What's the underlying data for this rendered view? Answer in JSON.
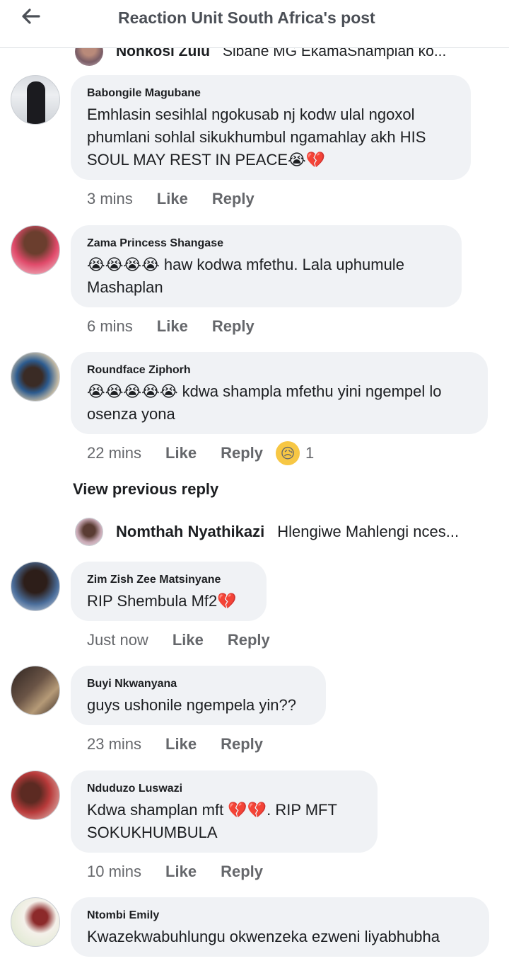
{
  "header": {
    "title": "Reaction Unit South Africa's post",
    "back_icon": "arrow-left-icon"
  },
  "partial_reply": {
    "name": "Nonkosi Zulu",
    "text": "Sibane MG EkamaShamplan ko..."
  },
  "comments": [
    {
      "author": "Babongile Magubane",
      "text": "Emhlasin sesihlal ngokusab nj kodw ulal ngoxol phumlani sohlal sikukhumbul ngamahlay akh HIS SOUL MAY REST IN PEACE😭💔",
      "time": "3 mins",
      "like": "Like",
      "reply": "Reply"
    },
    {
      "author": "Zama Princess Shangase",
      "text": "😭😭😭😭 haw kodwa mfethu. Lala uphumule Mashaplan",
      "time": "6 mins",
      "like": "Like",
      "reply": "Reply"
    },
    {
      "author": "Roundface Ziphorh",
      "text": "😭😭😭😭😭 kdwa shampla mfethu yini ngempel lo osenza yona",
      "time": "22 mins",
      "like": "Like",
      "reply": "Reply",
      "reaction_emoji": "😥",
      "reaction_count": "1"
    },
    {
      "author": "Zim Zish Zee Matsinyane",
      "text": "RIP Shembula Mf2💔",
      "time": "Just now",
      "like": "Like",
      "reply": "Reply"
    },
    {
      "author": "Buyi Nkwanyana",
      "text": "guys ushonile ngempela yin??",
      "time": "23 mins",
      "like": "Like",
      "reply": "Reply"
    },
    {
      "author": "Nduduzo Luswazi",
      "text": "Kdwa shamplan mft 💔💔. RIP MFT SOKUKHUMBULA",
      "time": "10 mins",
      "like": "Like",
      "reply": "Reply"
    },
    {
      "author": "Ntombi Emily",
      "text": "Kwazekwabuhlungu okwenzeka ezweni  liyabhubha"
    }
  ],
  "view_previous": "View previous reply",
  "reply_preview": {
    "name": "Nomthah Nyathikazi",
    "text": "Hlengiwe Mahlengi nces..."
  },
  "colors": {
    "bubble": "#f0f2f5",
    "meta": "#65676b",
    "text": "#1c1e21"
  }
}
